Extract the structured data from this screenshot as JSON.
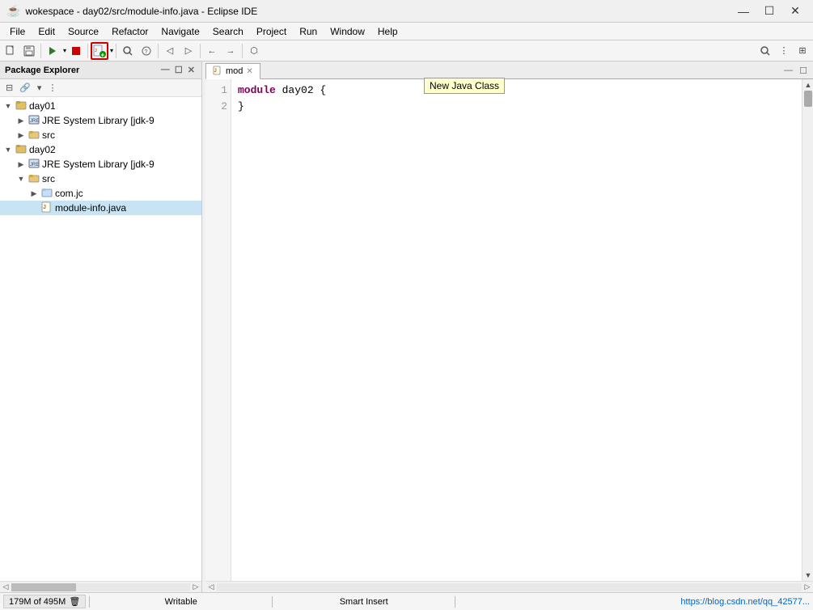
{
  "titlebar": {
    "icon": "☕",
    "title": "wokespace - day02/src/module-info.java - Eclipse IDE",
    "minimize": "—",
    "maximize": "☐",
    "close": "✕"
  },
  "menubar": {
    "items": [
      "File",
      "Edit",
      "Source",
      "Refactor",
      "Navigate",
      "Search",
      "Project",
      "Run",
      "Window",
      "Help"
    ]
  },
  "toolbar": {
    "buttons": [
      "≡",
      "💾",
      "⚡",
      "▶",
      "⬛",
      "⟳",
      "🔍",
      "🔎",
      "⚙",
      "📋",
      "✂",
      "📄",
      "🔗"
    ]
  },
  "package_explorer": {
    "title": "Package Explorer",
    "close_icon": "✕",
    "tree": [
      {
        "id": "day01",
        "label": "day01",
        "indent": 0,
        "expanded": true,
        "type": "project",
        "icon": "📁"
      },
      {
        "id": "jre-day01",
        "label": "JRE System Library [jdk-9",
        "indent": 1,
        "expanded": false,
        "type": "library",
        "icon": "📚"
      },
      {
        "id": "src-day01",
        "label": "src",
        "indent": 1,
        "expanded": false,
        "type": "folder",
        "icon": "📂"
      },
      {
        "id": "day02",
        "label": "day02",
        "indent": 0,
        "expanded": true,
        "type": "project",
        "icon": "📁"
      },
      {
        "id": "jre-day02",
        "label": "JRE System Library [jdk-9",
        "indent": 1,
        "expanded": false,
        "type": "library",
        "icon": "📚"
      },
      {
        "id": "src-day02",
        "label": "src",
        "indent": 1,
        "expanded": true,
        "type": "folder",
        "icon": "📂"
      },
      {
        "id": "comjc",
        "label": "com.jc",
        "indent": 2,
        "expanded": false,
        "type": "package",
        "icon": "📦"
      },
      {
        "id": "moduleinfo",
        "label": "module-info.java",
        "indent": 2,
        "expanded": false,
        "type": "java",
        "icon": "📄",
        "selected": true
      }
    ]
  },
  "editor": {
    "tab_label": "mod",
    "tab_tooltip": "New Java Class",
    "tab_close": "✕",
    "line_numbers": [
      "1",
      "2"
    ],
    "code_lines": [
      {
        "line": 1,
        "content_raw": "module day02 {",
        "has_keyword": true,
        "keyword": "module",
        "rest": " day02 {"
      },
      {
        "line": 2,
        "content_raw": "}",
        "has_keyword": false
      }
    ]
  },
  "statusbar": {
    "memory": "179M of 495M",
    "trash_icon": "🗑",
    "writable": "Writable",
    "smart_insert": "Smart Insert",
    "url": "https://blog.csdn.net/qq_42577..."
  }
}
